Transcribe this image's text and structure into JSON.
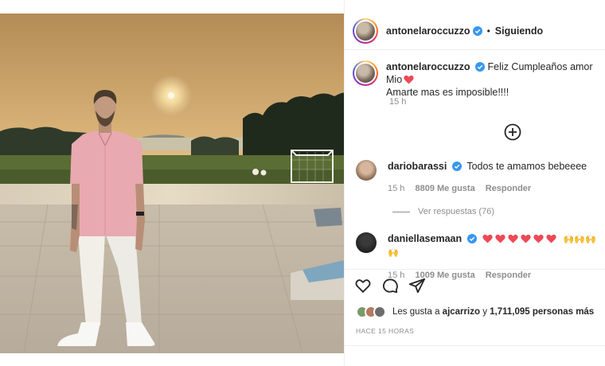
{
  "post": {
    "photo_icon": "photo-man-pink-shirt-sunset",
    "author": "antonelaroccuzzo",
    "follow_status": "Siguiendo",
    "separator": "•",
    "caption_author": "antonelaroccuzzo",
    "caption_text_1": "Feliz Cumpleaños amor Mio",
    "caption_text_2": "Amarte mas es imposible!!!!",
    "caption_time": "15 h",
    "load_more_icon": "plus-circle-icon"
  },
  "comments": [
    {
      "author": "dariobarassi",
      "text": "Todos te amamos bebeeee",
      "time": "15 h",
      "likes": "8809 Me gusta",
      "reply_label": "Responder",
      "view_replies": "Ver respuestas (76)"
    },
    {
      "author": "daniellasemaan",
      "hearts": 6,
      "praying_hands": "🙌🙌🙌🙌",
      "time": "15 h",
      "likes": "1009 Me gusta",
      "reply_label": "Responder"
    }
  ],
  "actions": {
    "like_icon": "heart-outline-icon",
    "comment_icon": "comment-bubble-icon",
    "share_icon": "paper-plane-icon"
  },
  "likes": {
    "prefix": "Les gusta a",
    "user": "ajcarrizo",
    "connector": "y",
    "count_text": "1,711,095 personas más"
  },
  "posted_ago": "HACE 15 HORAS",
  "colors": {
    "verified": "#3897f0",
    "heart": "#ed4956",
    "text": "#262626",
    "secondary": "#8e8e8e"
  }
}
